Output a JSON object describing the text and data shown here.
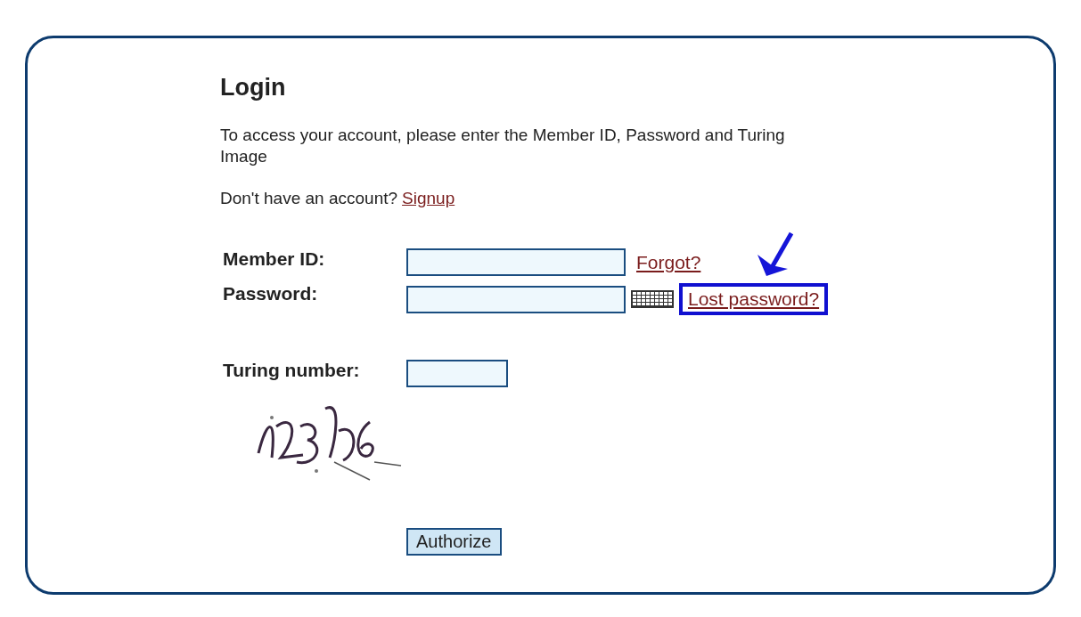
{
  "heading": "Login",
  "intro": "To access your account, please enter the Member ID, Password and Turing Image",
  "signup_prompt": {
    "text": "Don't have an account?",
    "link": "Signup"
  },
  "fields": [
    {
      "label": "Member ID:",
      "link": "Forgot?",
      "keyboard": false,
      "highlighted": false
    },
    {
      "label": "Password:",
      "link": "Lost password?",
      "keyboard": true,
      "highlighted": true
    }
  ],
  "turing": {
    "label": "Turing number:"
  },
  "button": "Authorize"
}
